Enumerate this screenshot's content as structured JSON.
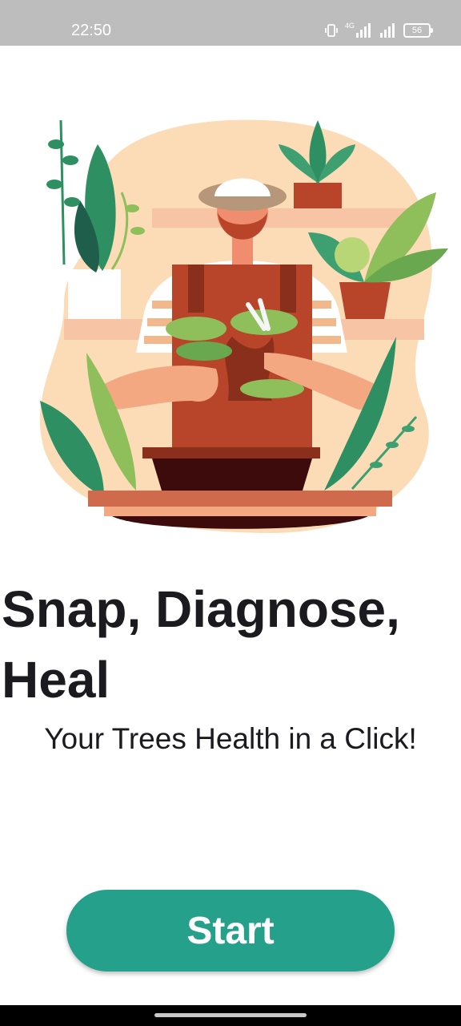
{
  "status_bar": {
    "time": "22:50",
    "network_label": "4G",
    "battery_level": "56",
    "icons": [
      "vibrate-icon",
      "signal-4g-icon",
      "signal-icon",
      "battery-icon"
    ]
  },
  "onboarding": {
    "illustration": "gardener-pruning-bonsai-illustration",
    "headline": "Snap, Diagnose, Heal",
    "subtitle": "Your Trees Health in a Click!",
    "start_label": "Start"
  },
  "colors": {
    "accent": "#25a08a",
    "text": "#1b1b1f",
    "illustration_background": "#fcdcb6"
  }
}
